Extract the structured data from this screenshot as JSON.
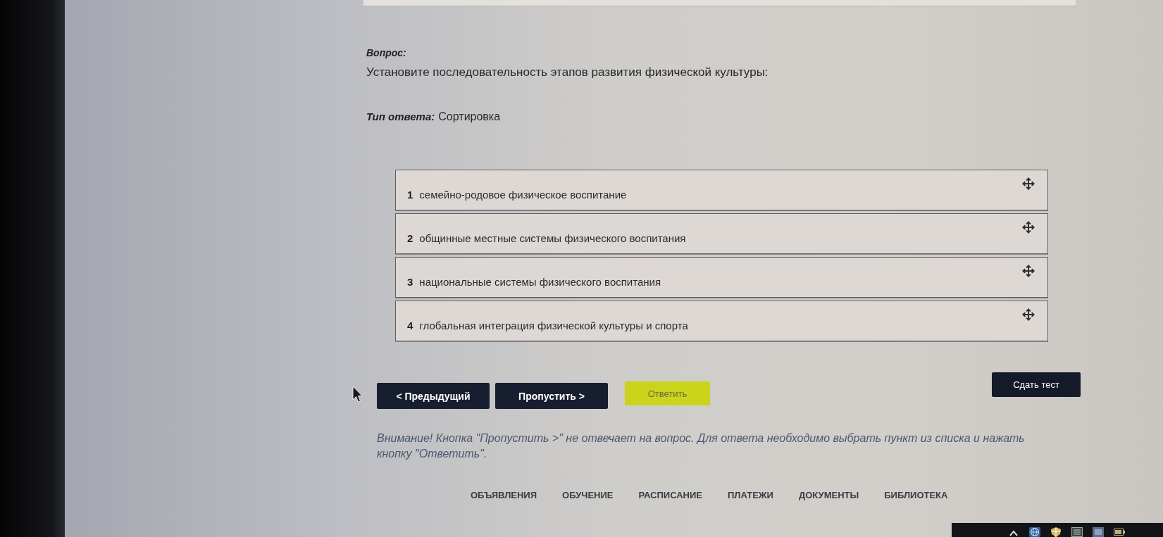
{
  "question": {
    "label": "Вопрос:",
    "text": "Установите последовательность этапов развития физической культуры:"
  },
  "answer_type": {
    "label": "Тип ответа:",
    "value": "Сортировка"
  },
  "sort_items": [
    {
      "number": "1",
      "text": "семейно-родовое физическое воспитание"
    },
    {
      "number": "2",
      "text": "общинные местные системы физического воспитания"
    },
    {
      "number": "3",
      "text": "национальные системы физического воспитания"
    },
    {
      "number": "4",
      "text": "глобальная интеграция физической культуры и спорта"
    }
  ],
  "buttons": [
    {
      "label": "< Предыдущий",
      "kind": "nav"
    },
    {
      "label": "Пропустить >",
      "kind": "nav"
    },
    {
      "label": "Ответить",
      "kind": "answer"
    },
    {
      "label": "Сдать тест",
      "kind": "submit"
    }
  ],
  "notice": "Внимание! Кнопка \"Пропустить >\" не отвечает на вопрос. Для ответа необходимо выбрать пункт из списка и нажать кнопку \"Ответить\".",
  "nav": [
    "ОБЪЯВЛЕНИЯ",
    "ОБУЧЕНИЕ",
    "РАСПИСАНИЕ",
    "ПЛАТЕЖИ",
    "ДОКУМЕНТЫ",
    "БИБЛИОТЕКА"
  ]
}
